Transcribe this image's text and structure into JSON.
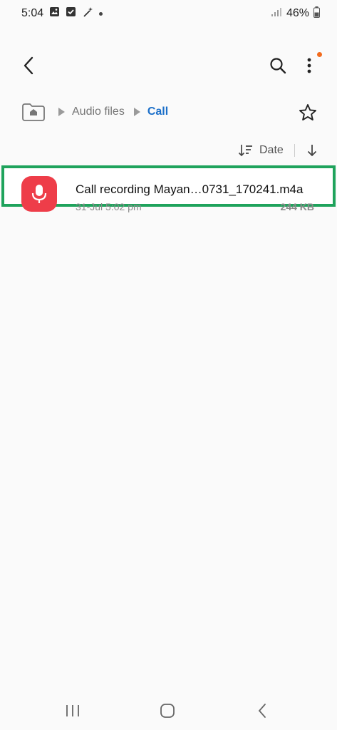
{
  "status_bar": {
    "time": "5:04",
    "battery": "46%",
    "icons": [
      "image-icon",
      "checkbox-icon",
      "magic-wand-icon",
      "dot-icon",
      "signal-icon",
      "battery-icon"
    ]
  },
  "app_bar": {
    "icons": [
      "back-icon",
      "search-icon",
      "more-vert-icon"
    ],
    "notification_color": "#f26b1d"
  },
  "breadcrumb": {
    "items": [
      "Audio files",
      "Call"
    ],
    "current_color": "#1b6fc9"
  },
  "sort": {
    "label": "Date"
  },
  "files": [
    {
      "name": "Call recording Mayan…0731_170241.m4a",
      "date": "31-Jul 5:02 pm",
      "size": "244 KB",
      "icon": "microphone-icon",
      "icon_color": "#ee3d49"
    }
  ],
  "highlight_color": "#1fa35c",
  "nav_bar": {
    "icons": [
      "recents-icon",
      "home-icon",
      "back-nav-icon"
    ]
  }
}
